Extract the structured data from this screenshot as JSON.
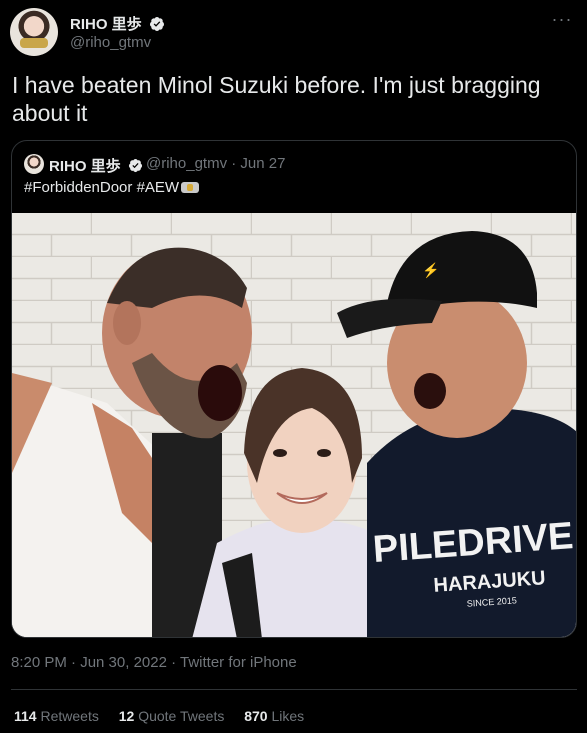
{
  "author": {
    "display_name": "RIHO 里歩",
    "handle": "@riho_gtmv",
    "avatar_icon": "avatar-photo",
    "verified_icon": "verified-badge-icon"
  },
  "tweet": {
    "text": "I have beaten Minol Suzuki before. I'm just bragging about it",
    "timestamp": "8:20 PM · Jun 30, 2022 · Twitter for iPhone"
  },
  "quoted_tweet": {
    "display_name": "RIHO 里歩",
    "handle": "@riho_gtmv",
    "date": "· Jun 27",
    "text": "#ForbiddenDoor #AEW",
    "emoji_icon": "championship-belt-icon",
    "photo": {
      "shirt_text_line1": "PILEDRIVE",
      "shirt_text_line2": "HARAJUKU",
      "shirt_text_line3": "SINCE 2015"
    }
  },
  "stats": {
    "retweets_count": "114",
    "retweets_label": "Retweets",
    "quotes_count": "12",
    "quotes_label": "Quote Tweets",
    "likes_count": "870",
    "likes_label": "Likes"
  },
  "colors": {
    "background": "#000000",
    "primary_text": "#e7e9ea",
    "secondary_text": "#71767b",
    "border": "#2f3336",
    "verified": "#1d9bf0"
  }
}
